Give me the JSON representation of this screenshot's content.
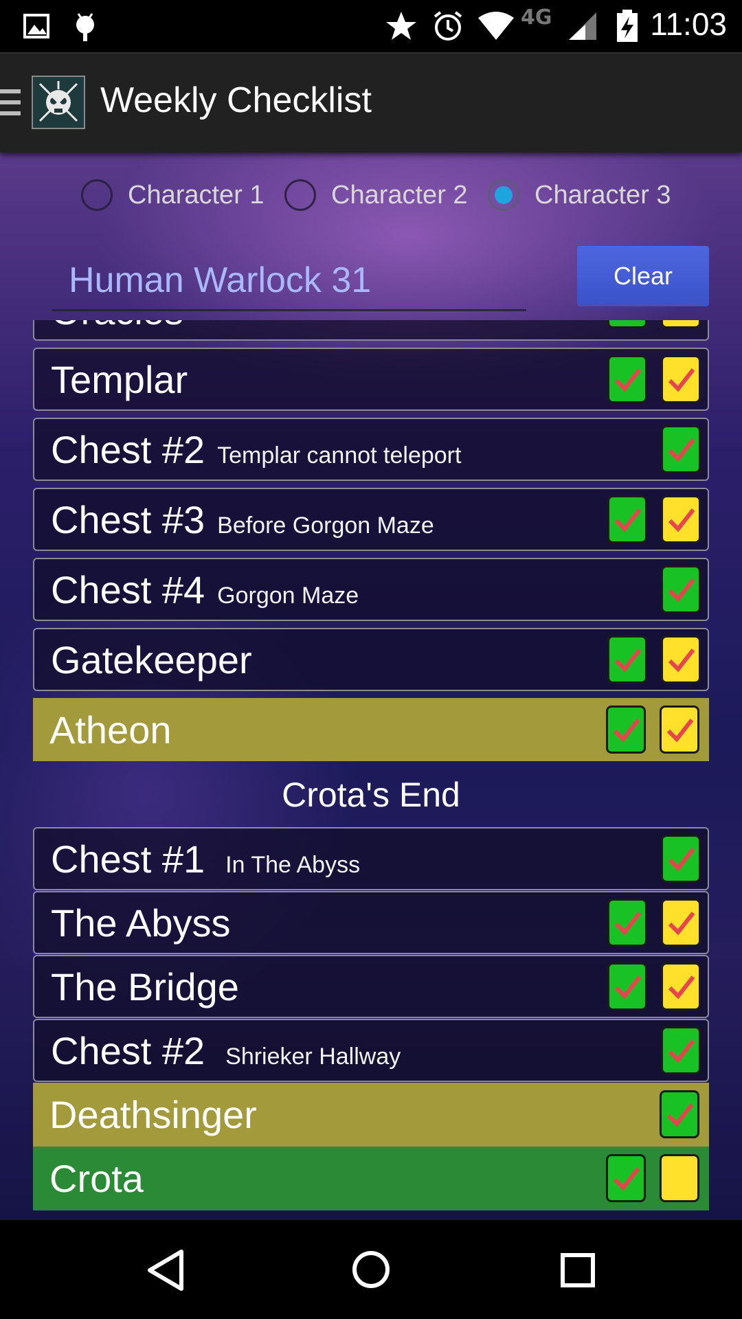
{
  "status_bar": {
    "time": "11:03",
    "network": "4G",
    "icons": [
      "image-icon",
      "android-icon",
      "star-icon",
      "alarm-icon",
      "wifi-icon",
      "network-4g-icon",
      "signal-icon",
      "battery-charging-icon"
    ]
  },
  "app_bar": {
    "title": "Weekly Checklist",
    "logo_icon": "destiny-skull-logo-icon",
    "menu_icon": "hamburger-menu-icon"
  },
  "characters": [
    {
      "label": "Character 1",
      "selected": false
    },
    {
      "label": "Character 2",
      "selected": false
    },
    {
      "label": "Character 3",
      "selected": true
    }
  ],
  "character_name": "Human Warlock 31",
  "clear_label": "Clear",
  "list": {
    "partial_top_label": "Oracles",
    "vault_rows": [
      {
        "title": "Templar",
        "subtitle": "",
        "style": "plain",
        "boxes": [
          "green-checked",
          "yellow-checked"
        ]
      },
      {
        "title": "Chest #2",
        "subtitle": "Templar cannot teleport",
        "style": "plain",
        "boxes": [
          "green-checked"
        ]
      },
      {
        "title": "Chest #3",
        "subtitle": "Before Gorgon Maze",
        "style": "plain",
        "boxes": [
          "green-checked",
          "yellow-checked"
        ]
      },
      {
        "title": "Chest #4",
        "subtitle": "Gorgon Maze",
        "style": "plain",
        "boxes": [
          "green-checked"
        ]
      },
      {
        "title": "Gatekeeper",
        "subtitle": "",
        "style": "plain",
        "boxes": [
          "green-checked",
          "yellow-checked"
        ]
      },
      {
        "title": "Atheon",
        "subtitle": "",
        "style": "gold",
        "boxes": [
          "green-checked",
          "yellow-checked"
        ]
      }
    ],
    "section_title": "Crota's End",
    "crota_rows": [
      {
        "title": "Chest #1",
        "subtitle": "In The Abyss",
        "style": "plain",
        "boxes": [
          "green-checked"
        ]
      },
      {
        "title": "The Abyss",
        "subtitle": "",
        "style": "plain",
        "boxes": [
          "green-checked",
          "yellow-checked"
        ]
      },
      {
        "title": "The Bridge",
        "subtitle": "",
        "style": "plain",
        "boxes": [
          "green-checked",
          "yellow-checked"
        ]
      },
      {
        "title": "Chest #2",
        "subtitle": "Shrieker Hallway",
        "style": "plain",
        "boxes": [
          "green-checked"
        ]
      },
      {
        "title": "Deathsinger",
        "subtitle": "",
        "style": "gold",
        "boxes": [
          "green-checked"
        ]
      },
      {
        "title": "Crota",
        "subtitle": "",
        "style": "green",
        "boxes": [
          "green-checked",
          "yellow-unchecked"
        ]
      }
    ]
  },
  "nav_bar": {
    "icons": [
      "back-icon",
      "home-icon",
      "recents-icon"
    ]
  },
  "colors": {
    "accent_radio": "#1fa4dd",
    "clear_button": "#4d67e0",
    "checkbox_green": "#19c224",
    "checkbox_yellow": "#ffe02b",
    "check_mark": "#e8434f",
    "gold_row": "#a39a3c",
    "green_row": "#2b8a35"
  }
}
